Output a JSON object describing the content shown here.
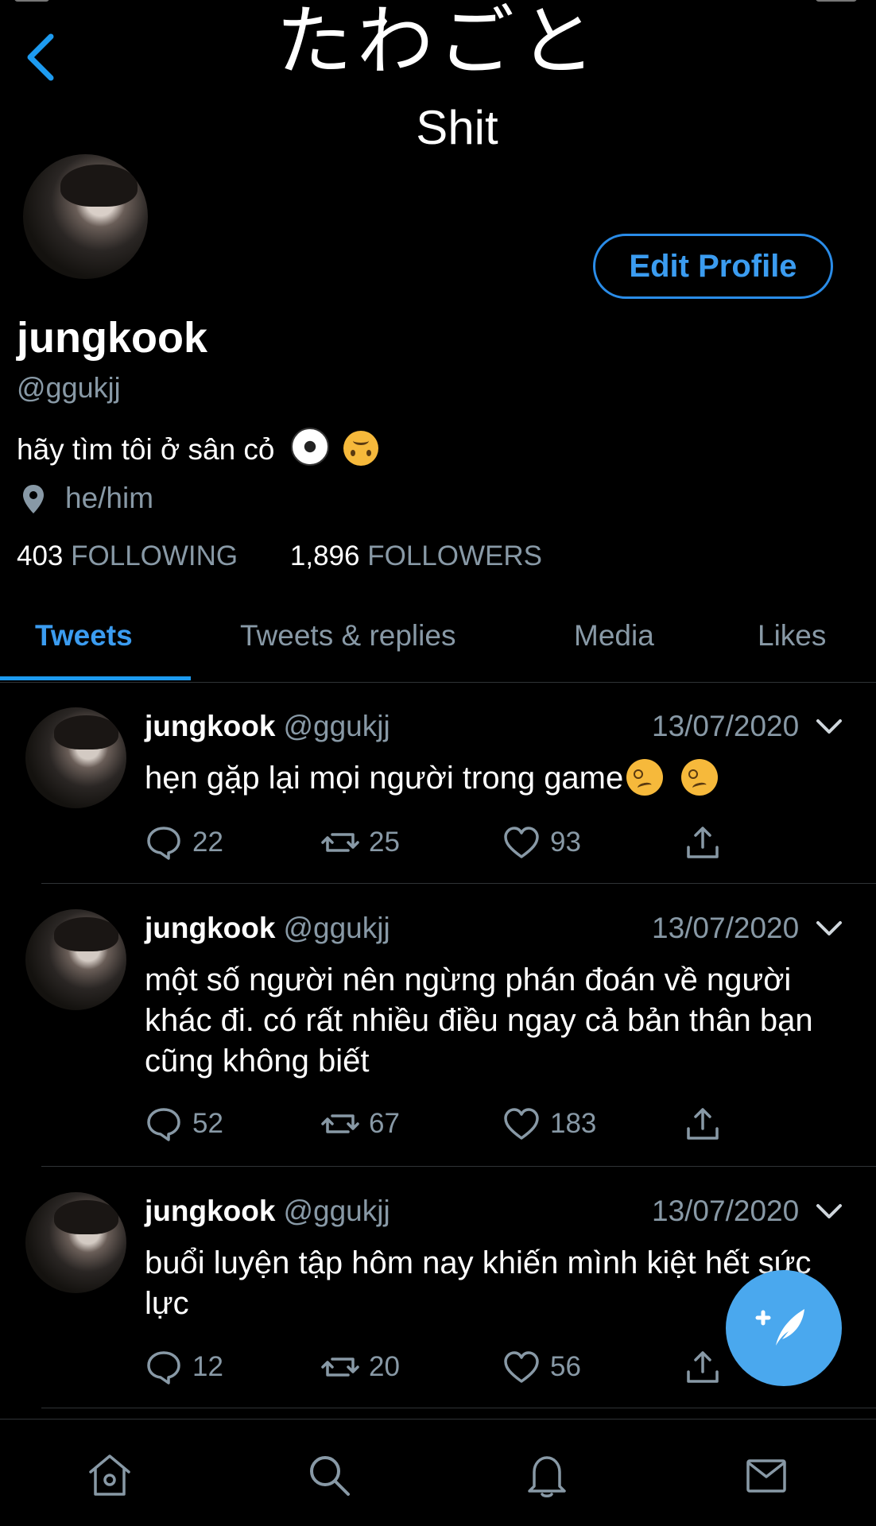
{
  "header": {
    "title_jp": "たわごと",
    "subtitle": "Shit"
  },
  "profile": {
    "name": "jungkook",
    "handle": "@ggukjj",
    "bio_text": "hãy tìm tôi ở sân cỏ",
    "bio_emojis": [
      "soccer-ball-emoji",
      "upside-down-face-emoji"
    ],
    "location": "he/him",
    "edit_button_label": "Edit Profile",
    "following_count": "403",
    "following_label": "FOLLOWING",
    "followers_count": "1,896",
    "followers_label": "FOLLOWERS"
  },
  "tabs": [
    {
      "label": "Tweets",
      "active": true
    },
    {
      "label": "Tweets & replies",
      "active": false
    },
    {
      "label": "Media",
      "active": false
    },
    {
      "label": "Likes",
      "active": false
    }
  ],
  "tweets": [
    {
      "name": "jungkook",
      "handle": "@ggukjj",
      "date": "13/07/2020",
      "text": "hẹn gặp lại mọi người trong game",
      "emojis": [
        "woozy-face-emoji",
        "woozy-face-emoji"
      ],
      "replies": "22",
      "retweets": "25",
      "likes": "93"
    },
    {
      "name": "jungkook",
      "handle": "@ggukjj",
      "date": "13/07/2020",
      "text": "một số người nên ngừng phán đoán về người khác đi. có rất nhiều điều ngay cả bản thân bạn cũng không biết",
      "replies": "52",
      "retweets": "67",
      "likes": "183"
    },
    {
      "name": "jungkook",
      "handle": "@ggukjj",
      "date": "13/07/2020",
      "text": "buổi luyện tập hôm nay khiến mình kiệt hết sức lực",
      "replies": "12",
      "retweets": "20",
      "likes": "56"
    }
  ],
  "colors": {
    "background": "#000000",
    "accent": "#1d9bf0",
    "secondary_text": "#8899a6",
    "fab": "#4aa8ee"
  },
  "icons": {
    "back": "chevron-left-icon",
    "location": "location-pin-icon",
    "reply": "reply-bubble-icon",
    "retweet": "retweet-icon",
    "like": "heart-icon",
    "share": "share-icon",
    "more": "chevron-down-icon",
    "compose": "compose-feather-icon",
    "nav": [
      "home-icon",
      "search-icon",
      "notifications-icon",
      "messages-icon"
    ]
  }
}
